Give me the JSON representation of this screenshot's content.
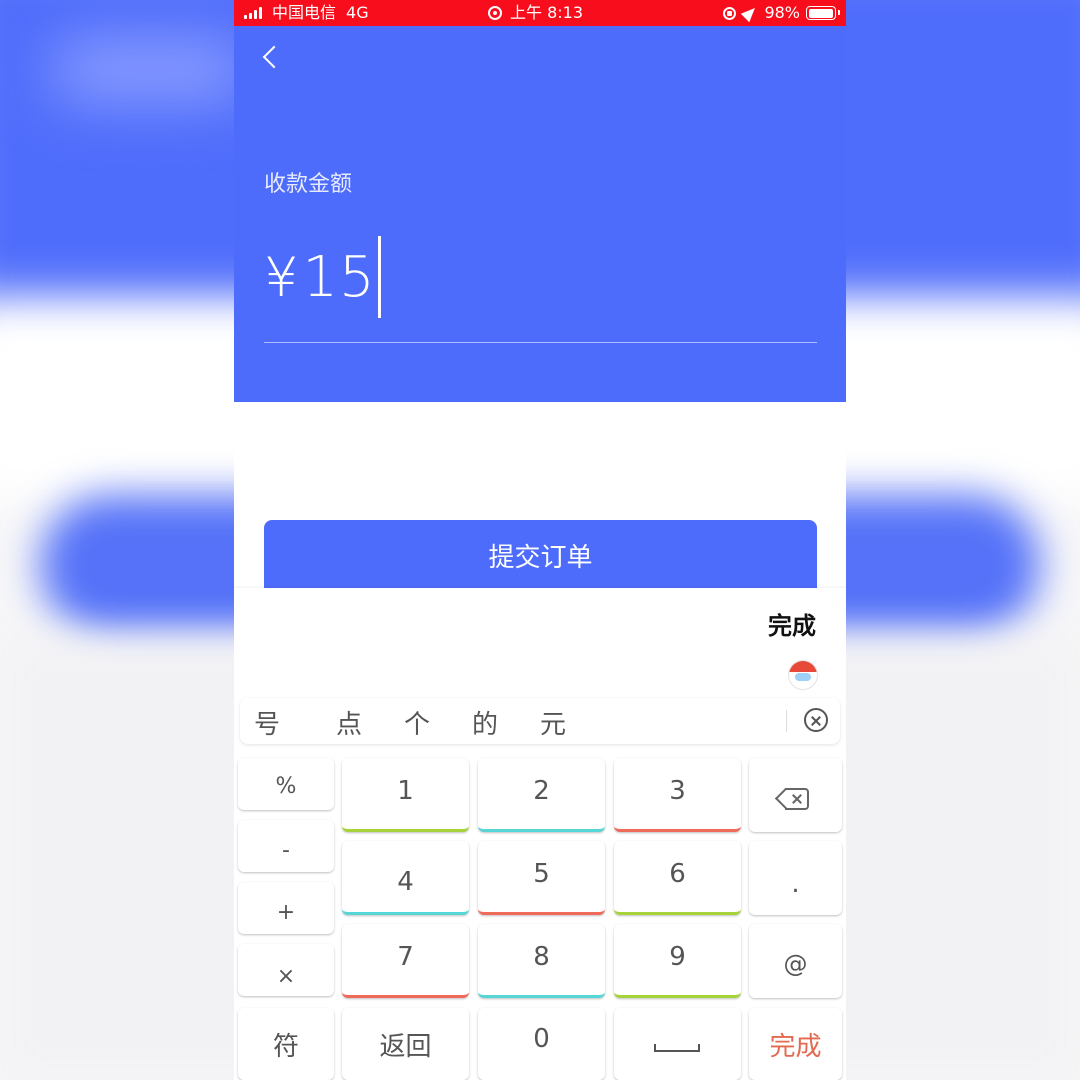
{
  "status_bar": {
    "carrier": "中国电信",
    "network": "4G",
    "time": "上午 8:13",
    "battery": "98%",
    "battery_level": 0.98
  },
  "header": {
    "amount_label": "收款金额",
    "currency": "¥",
    "amount": "15"
  },
  "submit_label": "提交订单",
  "keyboard": {
    "done_label": "完成",
    "candidates": [
      "号",
      "点",
      "个",
      "的",
      "元"
    ],
    "side_keys": [
      "%",
      "-",
      "+",
      "×"
    ],
    "num_keys": [
      "1",
      "2",
      "3",
      "4",
      "5",
      "6",
      "7",
      "8",
      "9"
    ],
    "right_keys": [
      ".",
      "@"
    ],
    "bottom": {
      "symbols": "符",
      "back": "返回",
      "zero": "0",
      "done": "完成"
    }
  },
  "colors": {
    "primary": "#4e6cfb",
    "status_bar": "#f80d1c",
    "done_key": "#e36a50"
  }
}
